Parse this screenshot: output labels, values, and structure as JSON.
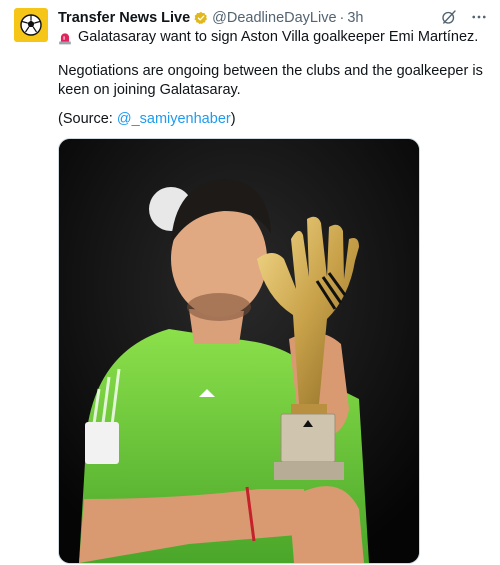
{
  "tweet": {
    "author_name": "Transfer News Live",
    "handle": "@DeadlineDayLive",
    "separator": "·",
    "time": "3h",
    "line1": "Galatasaray want to sign Aston Villa goalkeeper Emi Martínez.",
    "line2": "Negotiations are ongoing between the clubs and the goalkeeper is keen on joining Galatasaray.",
    "source_prefix": "(Source: ",
    "source_link": "@_samiyenhaber",
    "source_suffix": ")",
    "icons": {
      "avatar": "soccer-ball-icon",
      "verified": "verified-badge-icon",
      "grok": "grok-icon",
      "more": "more-icon",
      "siren": "rotating-light-icon"
    },
    "colors": {
      "link": "#1d9bf0",
      "verified": "#e2b719",
      "avatar_bg": "#f5c518"
    }
  }
}
